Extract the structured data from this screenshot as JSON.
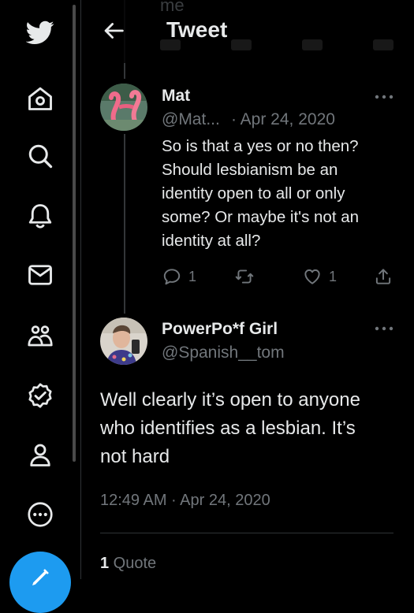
{
  "header": {
    "title": "Tweet",
    "partial_text": "me"
  },
  "nav": {
    "items": [
      {
        "icon": "twitter-logo-icon"
      },
      {
        "icon": "home-icon"
      },
      {
        "icon": "search-icon"
      },
      {
        "icon": "bell-icon"
      },
      {
        "icon": "mail-icon"
      },
      {
        "icon": "communities-icon"
      },
      {
        "icon": "verified-icon"
      },
      {
        "icon": "profile-icon"
      },
      {
        "icon": "more-icon"
      }
    ],
    "compose_icon": "compose-icon"
  },
  "reply_tweet": {
    "name": "Mat",
    "handle": "@Mat...",
    "date": "· Apr 24, 2020",
    "text_lines": [
      "So is that a yes or no then?",
      "Should lesbianism be an",
      "identity open to all or only",
      "some? Or maybe it's not an",
      "identity at all?"
    ],
    "reply_count": "1",
    "retweet_count": "",
    "like_count": "1"
  },
  "main_tweet": {
    "name": "PowerPo*f Girl",
    "handle": "@Spanish__tom",
    "text_lines": [
      "Well clearly it’s open to anyone",
      "who identifies as a lesbian. It’s",
      "not hard"
    ],
    "timestamp": "12:49 AM · Apr 24, 2020",
    "quote_count": "1",
    "quote_label": " Quote"
  },
  "colors": {
    "accent": "#1d9bf0",
    "muted": "#71767b",
    "text": "#e7e9ea",
    "border": "#2f3336"
  }
}
